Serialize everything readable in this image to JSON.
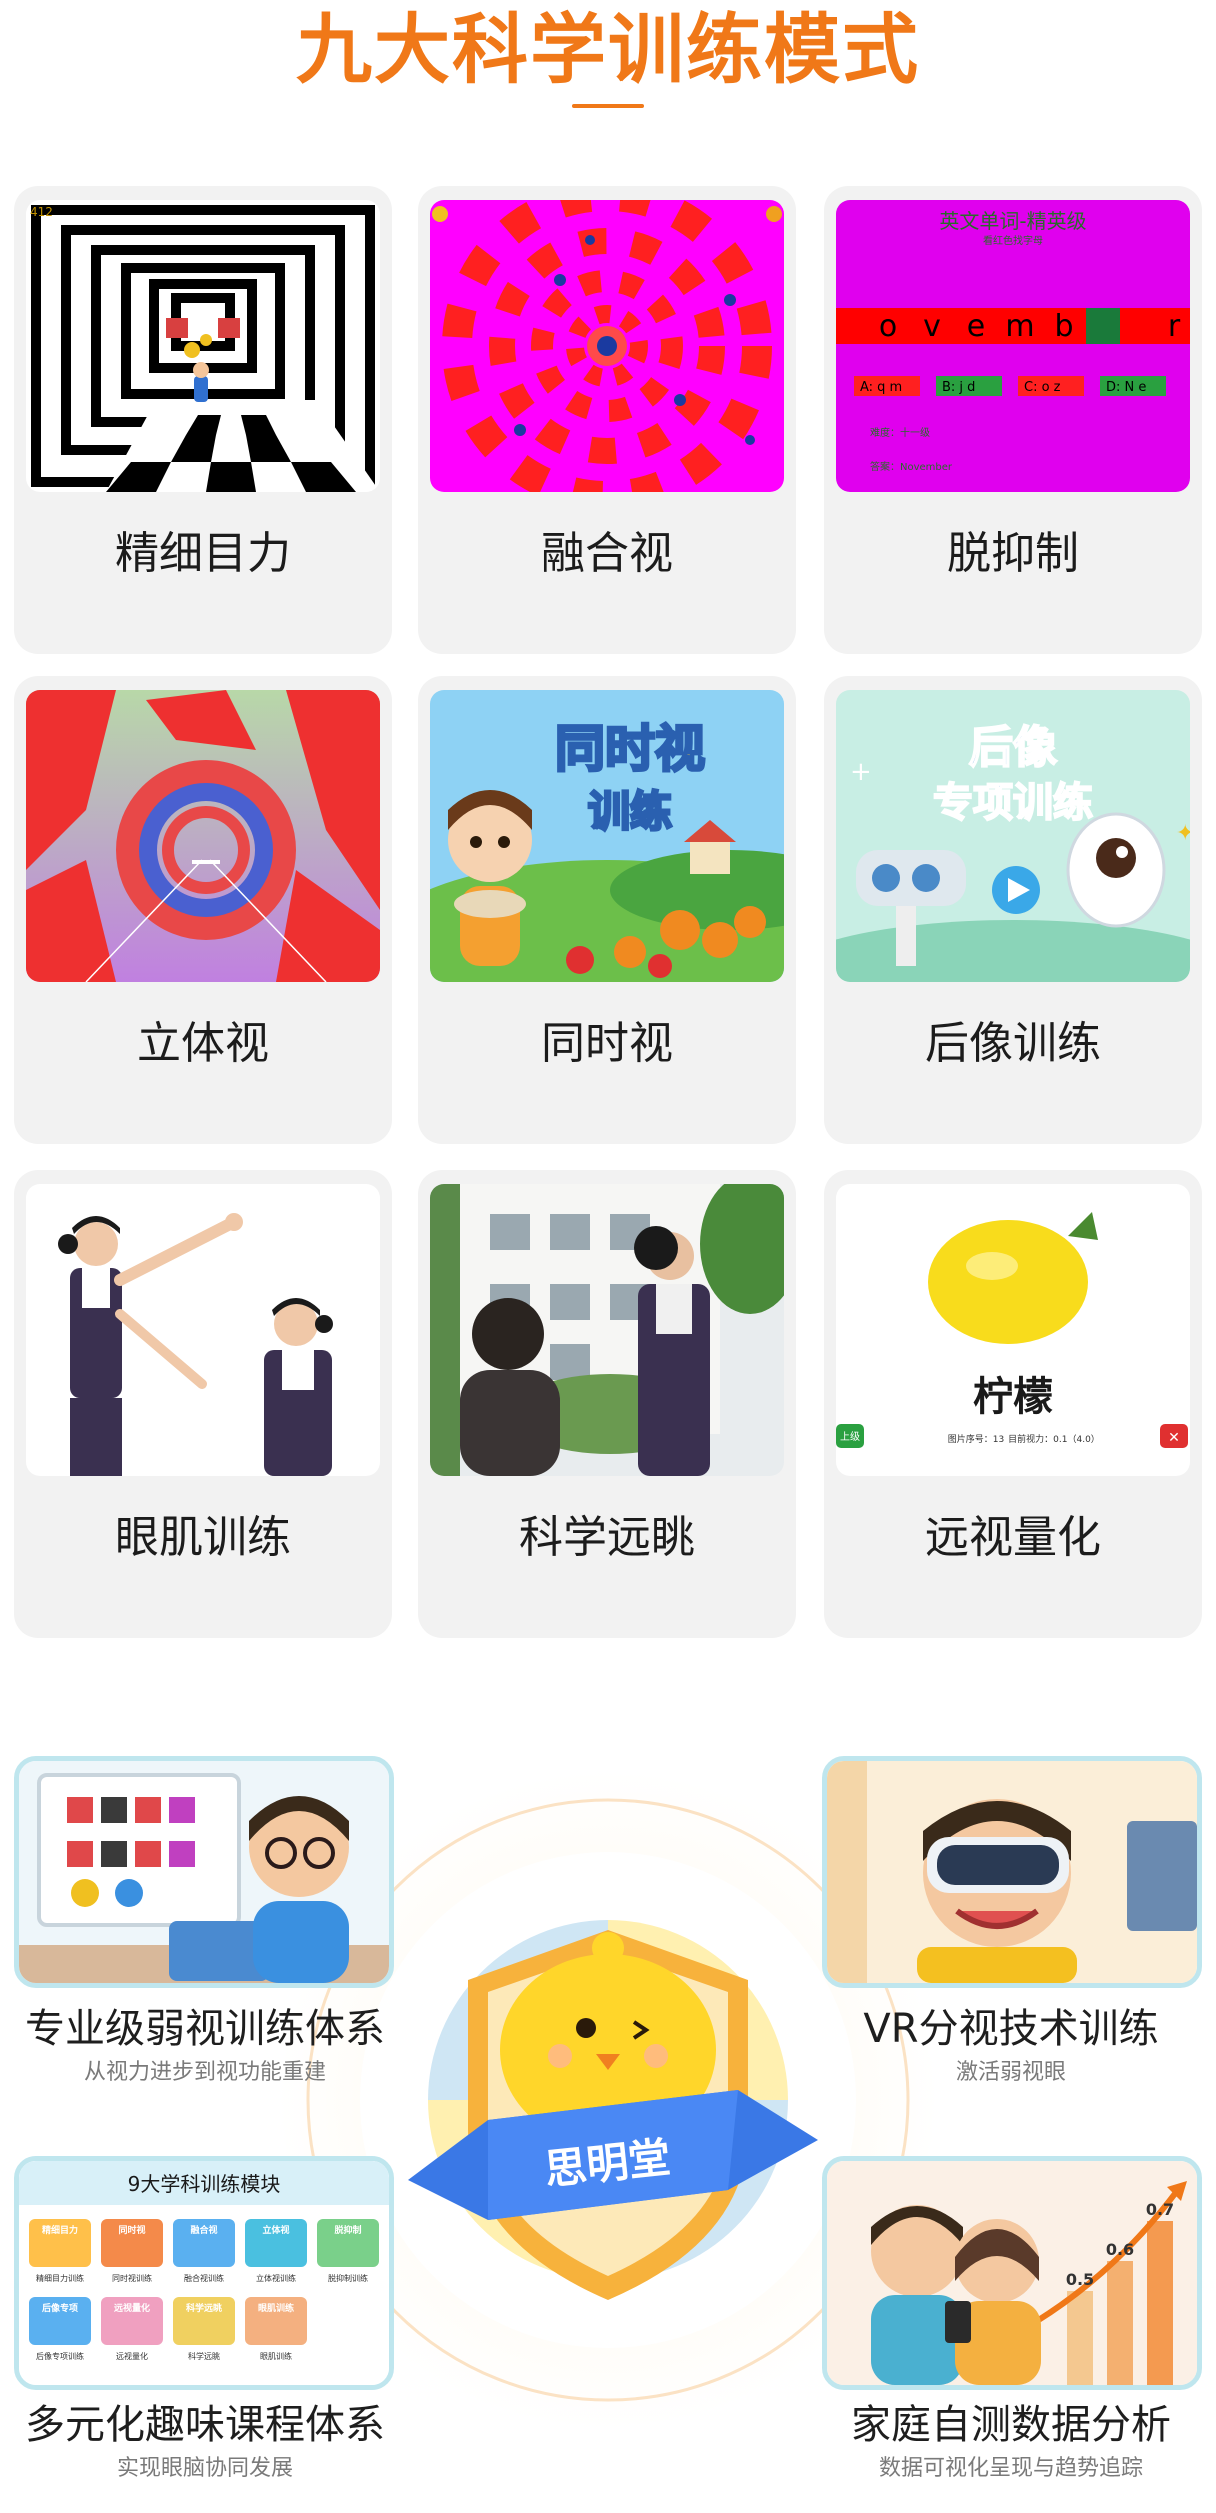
{
  "header": {
    "title": "九大科学训练模式"
  },
  "modes": [
    {
      "label": "精细目力"
    },
    {
      "label": "融合视"
    },
    {
      "label": "脱抑制"
    },
    {
      "label": "立体视"
    },
    {
      "label": "同时视"
    },
    {
      "label": "后像训练"
    },
    {
      "label": "眼肌训练"
    },
    {
      "label": "科学远眺"
    },
    {
      "label": "远视量化"
    }
  ],
  "thumbs": {
    "fine_hud": "412",
    "suppress_title": "英文单词-精英级",
    "suppress_subtitle": "看红色找字母",
    "suppress_letters": [
      "o",
      "v",
      "e",
      "m",
      "b",
      "r"
    ],
    "suppress_options": [
      "A: q m",
      "B: j d",
      "C: o z",
      "D: N e"
    ],
    "suppress_level": "难度：十一级",
    "suppress_answer": "答案：November",
    "simul_title_1": "同时视",
    "simul_title_2": "训练",
    "after_title_1": "后像",
    "after_title_2": "专项训练",
    "lemon_word": "柠檬",
    "lemon_left_button": "上级",
    "lemon_info_1": "图片序号：13",
    "lemon_info_2": "目前视力：0.1（4.0）",
    "lemon_close": "✕"
  },
  "features": [
    {
      "title": "专业级弱视训练体系",
      "subtitle": "从视力进步到视功能重建"
    },
    {
      "title": "VR分视技术训练",
      "subtitle": "激活弱视眼"
    },
    {
      "title": "多元化趣味课程体系",
      "subtitle": "实现眼脑协同发展"
    },
    {
      "title": "家庭自测数据分析",
      "subtitle": "数据可视化呈现与趋势追踪"
    }
  ],
  "modules_panel": {
    "title": "9大学科训练模块",
    "items": [
      "精细目力训练",
      "同时视训练",
      "融合视训练",
      "立体视训练",
      "脱抑制训练",
      "后像专项训练",
      "远视量化",
      "科学远眺",
      "眼肌训练"
    ],
    "tile_titles": [
      "精细目力",
      "同时视",
      "融合视",
      "立体视",
      "脱抑制",
      "后像专项",
      "远视量化",
      "科学远眺",
      "眼肌训练"
    ]
  },
  "chart_values": [
    "0.5",
    "0.6",
    "0.7"
  ],
  "brand": {
    "name": "思明堂"
  },
  "colors": {
    "accent": "#f07818",
    "card_bg": "#f2f2f2",
    "feature_border": "#bfe6ee",
    "ribbon": "#3a78e6"
  }
}
